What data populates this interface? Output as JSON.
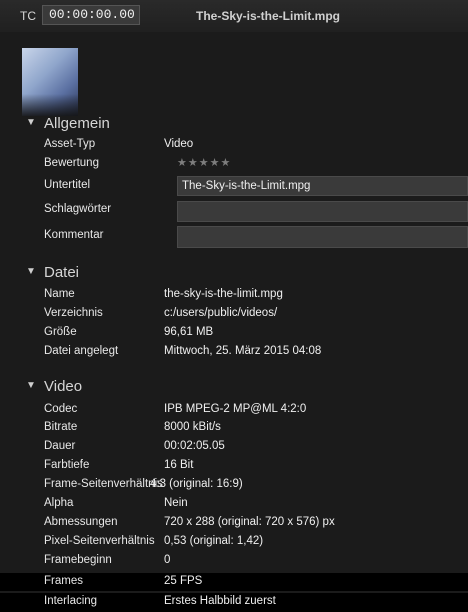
{
  "header": {
    "tc_label": "TC",
    "timecode": "00:00:00.00",
    "filename": "The-Sky-is-the-Limit.mpg"
  },
  "sections": {
    "general": {
      "title": "Allgemein",
      "asset_type_label": "Asset-Typ",
      "asset_type_value": "Video",
      "rating_label": "Bewertung",
      "rating_stars": "★★★★★",
      "subtitle_label": "Untertitel",
      "subtitle_value": "The-Sky-is-the-Limit.mpg",
      "keywords_label": "Schlagwörter",
      "keywords_value": "",
      "comment_label": "Kommentar",
      "comment_value": ""
    },
    "file": {
      "title": "Datei",
      "rows": [
        {
          "label": "Name",
          "value": "the-sky-is-the-limit.mpg"
        },
        {
          "label": "Verzeichnis",
          "value": "c:/users/public/videos/"
        },
        {
          "label": "Größe",
          "value": "96,61 MB"
        },
        {
          "label": "Datei angelegt",
          "value": "Mittwoch, 25. März 2015 04:08"
        }
      ]
    },
    "video": {
      "title": "Video",
      "rows": [
        {
          "label": "Codec",
          "value": "IPB MPEG-2  MP@ML 4:2:0"
        },
        {
          "label": "Bitrate",
          "value": "8000 kBit/s"
        },
        {
          "label": "Dauer",
          "value": "00:02:05.05"
        },
        {
          "label": "Farbtiefe",
          "value": "16 Bit"
        },
        {
          "label": "Frame-Seitenverhältnis",
          "value": "4:3 (original: 16:9)"
        },
        {
          "label": "Alpha",
          "value": "Nein"
        },
        {
          "label": "Abmessungen",
          "value": "720 x 288 (original: 720 x 576) px"
        },
        {
          "label": "Pixel-Seitenverhältnis",
          "value": "0,53 (original: 1,42)"
        },
        {
          "label": "Framebeginn",
          "value": "0"
        },
        {
          "label": "Frames",
          "value": "25 FPS"
        },
        {
          "label": "Interlacing",
          "value": "Erstes Halbbild zuerst"
        }
      ]
    }
  }
}
